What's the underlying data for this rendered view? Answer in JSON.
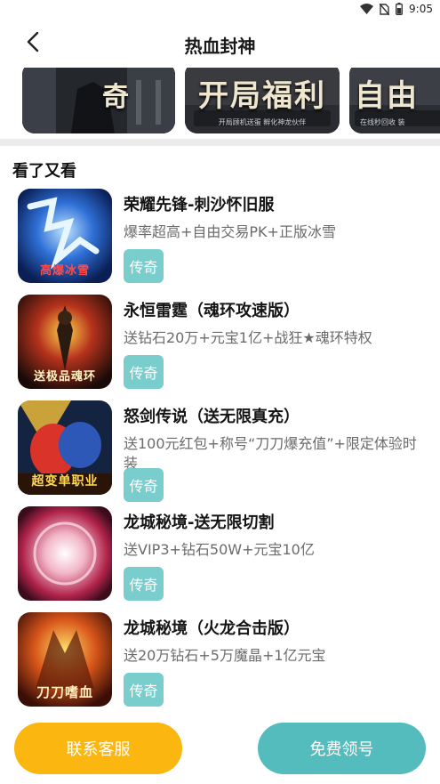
{
  "status_bar": {
    "time": "9:05",
    "icons": [
      "wifi-icon",
      "no-sim-icon",
      "battery-icon"
    ]
  },
  "header": {
    "title": "热血封神",
    "back_icon": "chevron-left-icon"
  },
  "banners": [
    {
      "big_text": "奇",
      "small_text": ""
    },
    {
      "big_text": "开局福利",
      "small_text": "开局顾机送蛋 孵化神龙伙伴"
    },
    {
      "big_text": "自由",
      "small_text": "在线秒回收 装"
    }
  ],
  "section": {
    "title": "看了又看"
  },
  "games": [
    {
      "name": "荣耀先锋-刺沙怀旧服",
      "desc": "爆率超高+自由交易PK+正版冰雪",
      "tag": "传奇",
      "icon_text": "高爆冰雪"
    },
    {
      "name": "永恒雷霆（魂环攻速版）",
      "desc": "送钻石20万+元宝1亿+战狂★魂环特权",
      "tag": "传奇",
      "icon_text": "送极品魂环"
    },
    {
      "name": "怒剑传说（送无限真充）",
      "desc": "送100元红包+称号“刀刀爆充值”+限定体验时装",
      "tag": "传奇",
      "icon_text": "超变单职业"
    },
    {
      "name": "龙城秘境-送无限切割",
      "desc": "送VIP3+钻石50W+元宝10亿",
      "tag": "传奇",
      "icon_text": ""
    },
    {
      "name": "龙城秘境（火龙合击版）",
      "desc": "送20万钻石+5万魔晶+1亿元宝",
      "tag": "传奇",
      "icon_text": "刀刀嗜血"
    }
  ],
  "footer": {
    "service_label": "联系客服",
    "claim_label": "免费领号"
  },
  "colors": {
    "tag": "#79cdcd",
    "service_button": "#fbb60f",
    "claim_button": "#55bcbd"
  }
}
